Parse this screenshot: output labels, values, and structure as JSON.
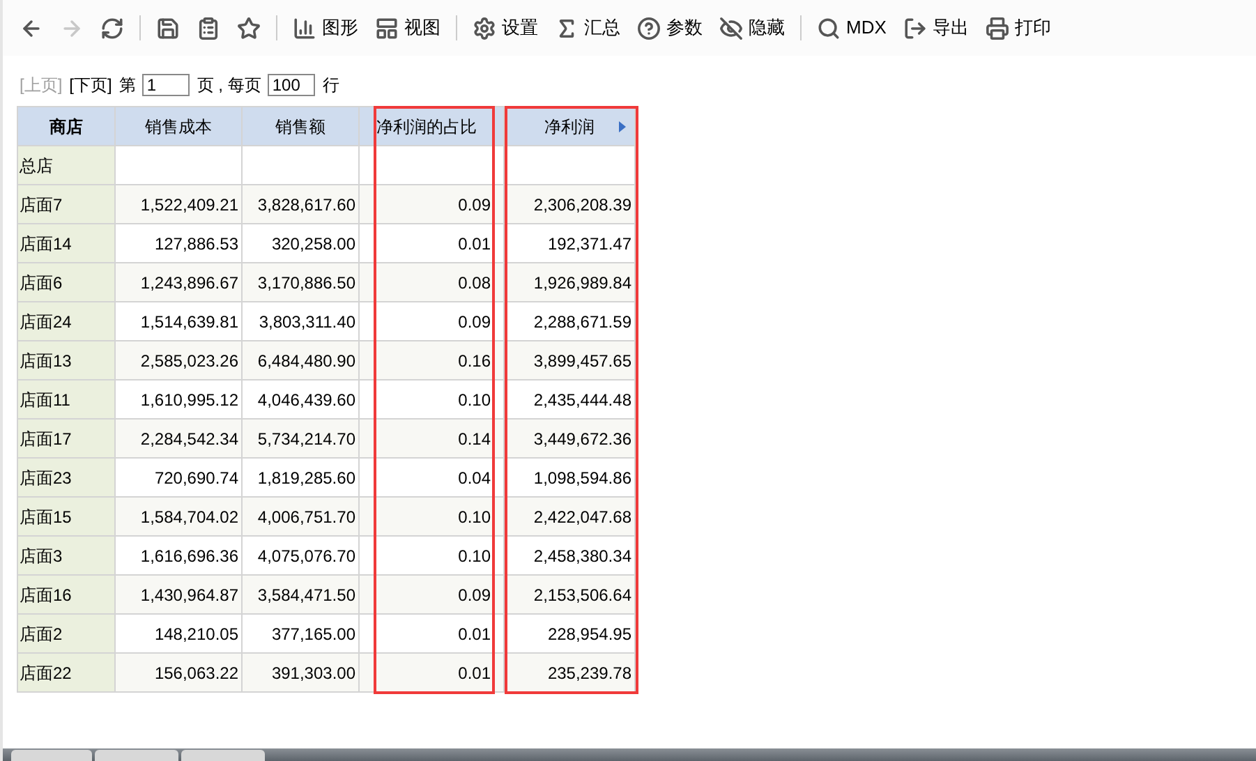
{
  "toolbar": [
    [
      {
        "disabled": false
      },
      {
        "disabled": true
      },
      {
        "disabled": false
      }
    ],
    [
      {
        "disabled": false
      },
      {
        "disabled": false
      },
      {
        "disabled": false
      }
    ],
    [
      {
        "label": "图形",
        "disabled": false
      },
      {
        "label": "视图",
        "disabled": false
      }
    ],
    [
      {
        "label": "设置",
        "disabled": false
      },
      {
        "label": "汇总",
        "disabled": false
      },
      {
        "label": "参数",
        "disabled": false
      },
      {
        "label": "隐藏",
        "disabled": false
      }
    ],
    [
      {
        "label": "MDX",
        "disabled": false
      },
      {
        "label": "导出",
        "disabled": false
      },
      {
        "label": "打印",
        "disabled": false
      }
    ]
  ],
  "pager": {
    "prev": {
      "label": "[上页]",
      "disabled": true
    },
    "next": {
      "label": "[下页]",
      "disabled": false
    },
    "page_prefix": "第",
    "page": "1",
    "per_page_label": "页 , 每页",
    "per_page": "100",
    "suffix": "行"
  },
  "table": {
    "columns": [
      {
        "label": "商店",
        "bold": true,
        "highlighted": false,
        "has_menu": false
      },
      {
        "label": "销售成本",
        "bold": false,
        "highlighted": false,
        "has_menu": false
      },
      {
        "label": "销售额",
        "bold": false,
        "highlighted": false,
        "has_menu": false
      },
      {
        "label": "净利润的占比",
        "bold": false,
        "highlighted": true,
        "has_menu": false
      },
      {
        "label": "净利润",
        "bold": false,
        "highlighted": true,
        "has_menu": true
      }
    ],
    "rows": [
      {
        "store": "总店",
        "values": []
      },
      {
        "store": "店面7",
        "values": [
          "1,522,409.21",
          "3,828,617.60",
          "0.09",
          "2,306,208.39"
        ]
      },
      {
        "store": "店面14",
        "values": [
          "127,886.53",
          "320,258.00",
          "0.01",
          "192,371.47"
        ]
      },
      {
        "store": "店面6",
        "values": [
          "1,243,896.67",
          "3,170,886.50",
          "0.08",
          "1,926,989.84"
        ]
      },
      {
        "store": "店面24",
        "values": [
          "1,514,639.81",
          "3,803,311.40",
          "0.09",
          "2,288,671.59"
        ]
      },
      {
        "store": "店面13",
        "values": [
          "2,585,023.26",
          "6,484,480.90",
          "0.16",
          "3,899,457.65"
        ]
      },
      {
        "store": "店面11",
        "values": [
          "1,610,995.12",
          "4,046,439.60",
          "0.10",
          "2,435,444.48"
        ]
      },
      {
        "store": "店面17",
        "values": [
          "2,284,542.34",
          "5,734,214.70",
          "0.14",
          "3,449,672.36"
        ]
      },
      {
        "store": "店面23",
        "values": [
          "720,690.74",
          "1,819,285.60",
          "0.04",
          "1,098,594.86"
        ]
      },
      {
        "store": "店面15",
        "values": [
          "1,584,704.02",
          "4,006,751.70",
          "0.10",
          "2,422,047.68"
        ]
      },
      {
        "store": "店面3",
        "values": [
          "1,616,696.36",
          "4,075,076.70",
          "0.10",
          "2,458,380.34"
        ]
      },
      {
        "store": "店面16",
        "values": [
          "1,430,964.87",
          "3,584,471.50",
          "0.09",
          "2,153,506.64"
        ]
      },
      {
        "store": "店面2",
        "values": [
          "148,210.05",
          "377,165.00",
          "0.01",
          "228,954.95"
        ]
      },
      {
        "store": "店面22",
        "values": [
          "156,063.22",
          "391,303.00",
          "0.01",
          "235,239.78"
        ]
      }
    ]
  }
}
